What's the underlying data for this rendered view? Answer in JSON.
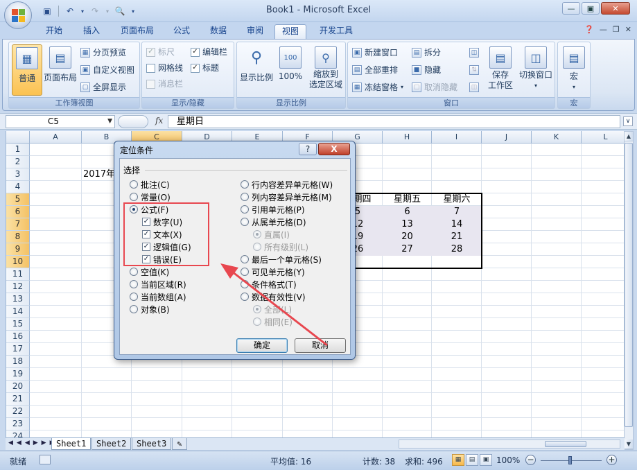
{
  "window": {
    "title": "Book1 - Microsoft Excel"
  },
  "qat_icons": [
    "save-icon",
    "undo-icon",
    "redo-icon",
    "print-preview-icon"
  ],
  "tabs": [
    {
      "label": "开始"
    },
    {
      "label": "插入"
    },
    {
      "label": "页面布局"
    },
    {
      "label": "公式"
    },
    {
      "label": "数据"
    },
    {
      "label": "审阅"
    },
    {
      "label": "视图"
    },
    {
      "label": "开发工具"
    }
  ],
  "active_tab": "视图",
  "ribbon": {
    "workbook_views": {
      "title": "工作簿视图",
      "normal": "普通",
      "page_layout": "页面布局",
      "page_break": "分页预览",
      "custom": "自定义视图",
      "fullscreen": "全屏显示"
    },
    "show_hide": {
      "title": "显示/隐藏",
      "ruler": "标尺",
      "gridlines": "网格线",
      "message_bar": "消息栏",
      "formula_bar": "编辑栏",
      "headings": "标题"
    },
    "zoom": {
      "title": "显示比例",
      "zoom": "显示比例",
      "zoom100": "100%",
      "zoom_sel_1": "缩放到",
      "zoom_sel_2": "选定区域"
    },
    "window": {
      "title": "窗口",
      "new_window": "新建窗口",
      "arrange_all": "全部重排",
      "freeze": "冻结窗格",
      "split": "拆分",
      "hide": "隐藏",
      "unhide": "取消隐藏",
      "save_1": "保存",
      "save_2": "工作区",
      "switch": "切换窗口"
    },
    "macros": {
      "title": "宏",
      "label": "宏"
    }
  },
  "formula_bar": {
    "name_box": "C5",
    "fx": "fx",
    "value": "星期日"
  },
  "columns": [
    "A",
    "B",
    "C",
    "D",
    "E",
    "F",
    "G",
    "H",
    "I",
    "J",
    "K",
    "L"
  ],
  "rows": [
    "1",
    "2",
    "3",
    "4",
    "5",
    "6",
    "7",
    "8",
    "9",
    "10",
    "11",
    "12",
    "13",
    "14",
    "15",
    "16",
    "17",
    "18",
    "19",
    "20",
    "21",
    "22",
    "23",
    "24"
  ],
  "cells": {
    "b3": "2017年",
    "headers": [
      "星期四",
      "星期五",
      "星期六"
    ],
    "r6": [
      "5",
      "6",
      "7"
    ],
    "r7": [
      "12",
      "13",
      "14"
    ],
    "r8": [
      "19",
      "20",
      "21"
    ],
    "r9": [
      "26",
      "27",
      "28"
    ]
  },
  "sheets": [
    "Sheet1",
    "Sheet2",
    "Sheet3"
  ],
  "status": {
    "ready": "就绪",
    "average": "平均值: 16",
    "count": "计数: 38",
    "sum": "求和: 496",
    "zoom": "100%"
  },
  "dialog": {
    "title": "定位条件",
    "help": "?",
    "close": "X",
    "group": "选择",
    "left": [
      {
        "label": "批注(C)",
        "type": "radio",
        "checked": false
      },
      {
        "label": "常量(O)",
        "type": "radio",
        "checked": false
      },
      {
        "label": "公式(F)",
        "type": "radio",
        "checked": true
      },
      {
        "label": "数字(U)",
        "type": "check",
        "checked": true
      },
      {
        "label": "文本(X)",
        "type": "check",
        "checked": true
      },
      {
        "label": "逻辑值(G)",
        "type": "check",
        "checked": true
      },
      {
        "label": "错误(E)",
        "type": "check",
        "checked": true
      },
      {
        "label": "空值(K)",
        "type": "radio",
        "checked": false
      },
      {
        "label": "当前区域(R)",
        "type": "radio",
        "checked": false
      },
      {
        "label": "当前数组(A)",
        "type": "radio",
        "checked": false
      },
      {
        "label": "对象(B)",
        "type": "radio",
        "checked": false
      }
    ],
    "right": [
      {
        "label": "行内容差异单元格(W)",
        "type": "radio",
        "checked": false
      },
      {
        "label": "列内容差异单元格(M)",
        "type": "radio",
        "checked": false
      },
      {
        "label": "引用单元格(P)",
        "type": "radio",
        "checked": false
      },
      {
        "label": "从属单元格(D)",
        "type": "radio",
        "checked": false
      },
      {
        "label": "直属(I)",
        "type": "radio",
        "checked": true,
        "disabled": true
      },
      {
        "label": "所有级别(L)",
        "type": "radio",
        "checked": false,
        "disabled": true
      },
      {
        "label": "最后一个单元格(S)",
        "type": "radio",
        "checked": false
      },
      {
        "label": "可见单元格(Y)",
        "type": "radio",
        "checked": false
      },
      {
        "label": "条件格式(T)",
        "type": "radio",
        "checked": false
      },
      {
        "label": "数据有效性(V)",
        "type": "radio",
        "checked": false
      },
      {
        "label": "全部(L)",
        "type": "radio",
        "checked": true,
        "disabled": true
      },
      {
        "label": "相同(E)",
        "type": "radio",
        "checked": false,
        "disabled": true
      }
    ],
    "ok": "确定",
    "cancel": "取消"
  },
  "colors": {
    "annotation": "#e8474f",
    "selected_header": "#f4c266"
  }
}
